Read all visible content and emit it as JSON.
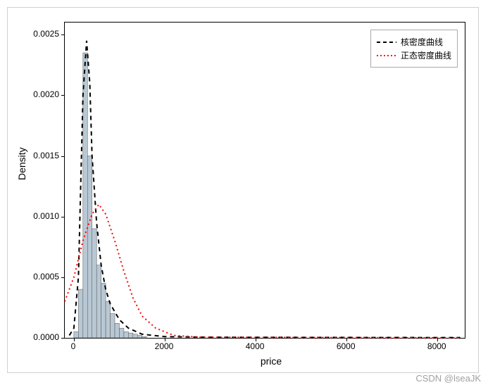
{
  "chart_data": {
    "type": "histogram+line",
    "title": "",
    "xlabel": "price",
    "ylabel": "Density",
    "xlim": [
      -200,
      8600
    ],
    "ylim": [
      0,
      0.0026
    ],
    "xticks": [
      0,
      2000,
      4000,
      6000,
      8000
    ],
    "yticks": [
      0.0,
      0.0005,
      0.001,
      0.0015,
      0.002,
      0.0025
    ],
    "ytick_labels": [
      "0.0000",
      "0.0005",
      "0.0010",
      "0.0015",
      "0.0020",
      "0.0025"
    ],
    "histogram": {
      "bin_width": 100,
      "bins": [
        {
          "x": 0,
          "density": 5e-05
        },
        {
          "x": 100,
          "density": 0.0004
        },
        {
          "x": 200,
          "density": 0.00235
        },
        {
          "x": 300,
          "density": 0.0015
        },
        {
          "x": 400,
          "density": 0.0009
        },
        {
          "x": 500,
          "density": 0.0006
        },
        {
          "x": 600,
          "density": 0.00045
        },
        {
          "x": 700,
          "density": 0.0003
        },
        {
          "x": 800,
          "density": 0.0002
        },
        {
          "x": 900,
          "density": 0.00012
        },
        {
          "x": 1000,
          "density": 8e-05
        },
        {
          "x": 1100,
          "density": 5e-05
        },
        {
          "x": 1200,
          "density": 4e-05
        },
        {
          "x": 1300,
          "density": 3e-05
        },
        {
          "x": 1400,
          "density": 2e-05
        },
        {
          "x": 1500,
          "density": 1e-05
        }
      ]
    },
    "series": [
      {
        "name": "核密度曲线",
        "style": "dashed",
        "color": "#000000",
        "points": [
          {
            "x": -100,
            "y": 2e-05
          },
          {
            "x": 0,
            "y": 8e-05
          },
          {
            "x": 100,
            "y": 0.0005
          },
          {
            "x": 200,
            "y": 0.002
          },
          {
            "x": 280,
            "y": 0.00245
          },
          {
            "x": 350,
            "y": 0.0021
          },
          {
            "x": 400,
            "y": 0.0015
          },
          {
            "x": 500,
            "y": 0.00095
          },
          {
            "x": 600,
            "y": 0.0006
          },
          {
            "x": 700,
            "y": 0.0004
          },
          {
            "x": 800,
            "y": 0.00028
          },
          {
            "x": 1000,
            "y": 0.00015
          },
          {
            "x": 1200,
            "y": 8e-05
          },
          {
            "x": 1500,
            "y": 3e-05
          },
          {
            "x": 2000,
            "y": 1e-05
          },
          {
            "x": 3000,
            "y": 5e-06
          },
          {
            "x": 8500,
            "y": 2e-06
          }
        ]
      },
      {
        "name": "正态密度曲线",
        "style": "dotted",
        "color": "#ff0000",
        "points": [
          {
            "x": -200,
            "y": 0.0003
          },
          {
            "x": 0,
            "y": 0.0005
          },
          {
            "x": 200,
            "y": 0.0008
          },
          {
            "x": 400,
            "y": 0.00102
          },
          {
            "x": 550,
            "y": 0.0011
          },
          {
            "x": 700,
            "y": 0.00102
          },
          {
            "x": 900,
            "y": 0.0008
          },
          {
            "x": 1100,
            "y": 0.00055
          },
          {
            "x": 1300,
            "y": 0.00033
          },
          {
            "x": 1500,
            "y": 0.00018
          },
          {
            "x": 1800,
            "y": 8e-05
          },
          {
            "x": 2200,
            "y": 2e-05
          },
          {
            "x": 2800,
            "y": 5e-06
          },
          {
            "x": 8500,
            "y": 0.0
          }
        ]
      }
    ],
    "legend": {
      "position": "upper right",
      "entries": [
        "核密度曲线",
        "正态密度曲线"
      ]
    }
  },
  "watermark": "CSDN @lseaJK"
}
